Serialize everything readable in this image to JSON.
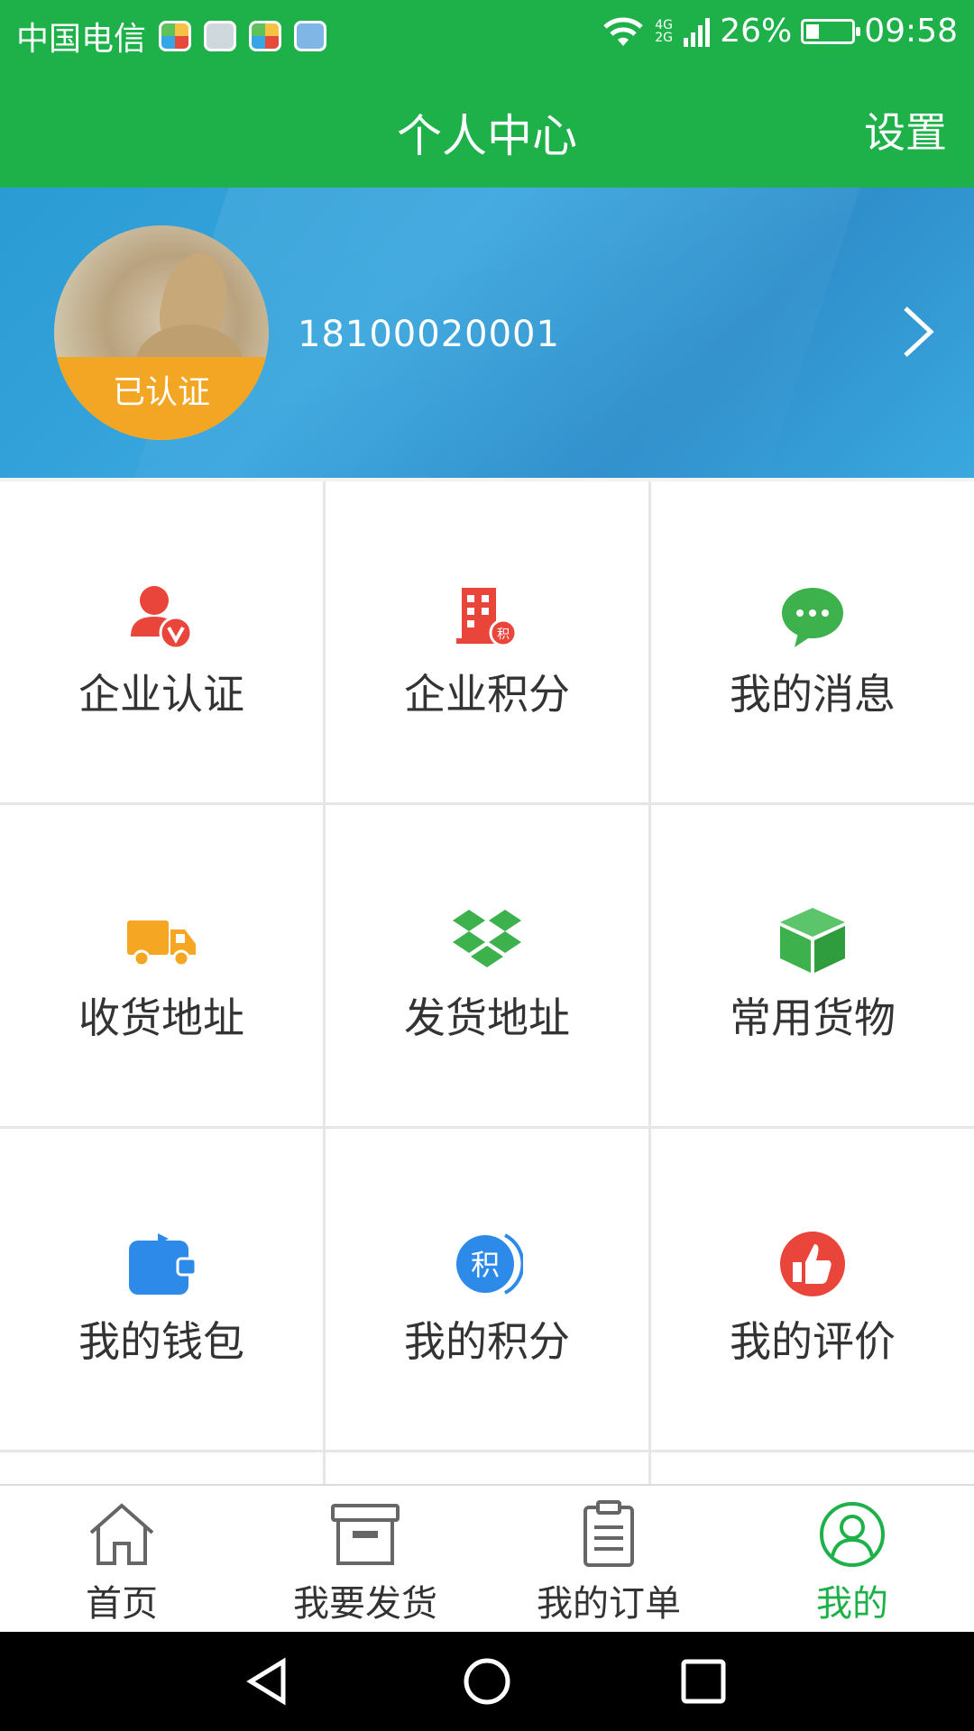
{
  "status_bar": {
    "carrier": "中国电信",
    "network": "4G 2G",
    "battery_percent": "26%",
    "time": "09:58"
  },
  "header": {
    "title": "个人中心",
    "settings_label": "设置"
  },
  "profile": {
    "phone": "18100020001",
    "verified_label": "已认证"
  },
  "menu": {
    "items": [
      {
        "label": "企业认证",
        "icon": "user-verified-icon",
        "color": "#e9453b"
      },
      {
        "label": "企业积分",
        "icon": "building-points-icon",
        "color": "#e9453b"
      },
      {
        "label": "我的消息",
        "icon": "chat-bubble-icon",
        "color": "#3db24c"
      },
      {
        "label": "收货地址",
        "icon": "delivery-truck-icon",
        "color": "#f5a623"
      },
      {
        "label": "发货地址",
        "icon": "dropbox-icon",
        "color": "#3db24c"
      },
      {
        "label": "常用货物",
        "icon": "box-icon",
        "color": "#3db24c"
      },
      {
        "label": "我的钱包",
        "icon": "wallet-icon",
        "color": "#2d8ae8"
      },
      {
        "label": "我的积分",
        "icon": "points-icon",
        "color": "#2d8ae8"
      },
      {
        "label": "我的评价",
        "icon": "thumbs-up-icon",
        "color": "#e9453b"
      }
    ],
    "points_glyph": "积"
  },
  "bottom_nav": {
    "items": [
      {
        "label": "首页",
        "icon": "home-icon"
      },
      {
        "label": "我要发货",
        "icon": "archive-box-icon"
      },
      {
        "label": "我的订单",
        "icon": "clipboard-icon"
      },
      {
        "label": "我的",
        "icon": "user-circle-icon",
        "active": true
      }
    ],
    "active_color": "#1eb14a"
  },
  "system_nav": {
    "buttons": [
      "back-icon",
      "home-circle-icon",
      "recents-square-icon"
    ]
  },
  "colors": {
    "brand_green": "#1eb14a",
    "banner_blue": "#2a9bd3",
    "verified_orange": "#f2a623"
  }
}
